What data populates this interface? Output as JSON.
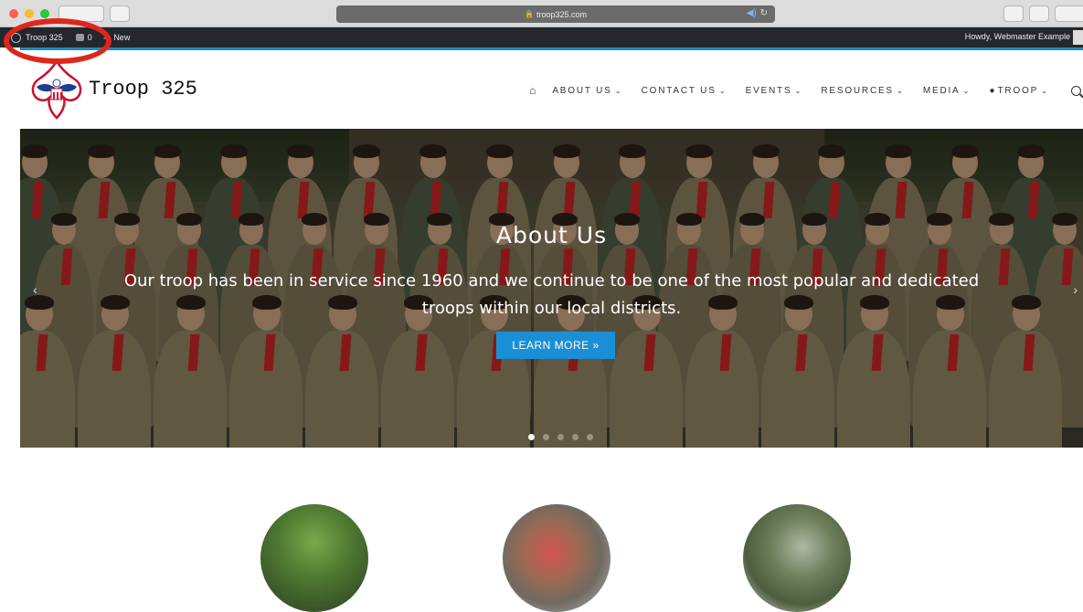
{
  "browser": {
    "url": "troop325.com"
  },
  "adminbar": {
    "site_name": "Troop 325",
    "comments_count": "0",
    "new_label": "New",
    "howdy": "Howdy, Webmaster Example"
  },
  "site": {
    "title": "Troop 325"
  },
  "nav": {
    "items": [
      {
        "label": "ABOUT US"
      },
      {
        "label": "CONTACT US"
      },
      {
        "label": "EVENTS"
      },
      {
        "label": "RESOURCES"
      },
      {
        "label": "MEDIA"
      },
      {
        "label": "TROOP"
      }
    ]
  },
  "hero": {
    "title": "About Us",
    "text": "Our troop has been in service since 1960 and we continue to be one of the most popular and dedicated troops within our local districts.",
    "button_label": "LEARN MORE »",
    "active_slide": 1,
    "slide_count": 5
  },
  "colors": {
    "admin_bar": "#23282d",
    "accent_blue": "#1a8fd6",
    "annotation_red": "#e0251b"
  }
}
